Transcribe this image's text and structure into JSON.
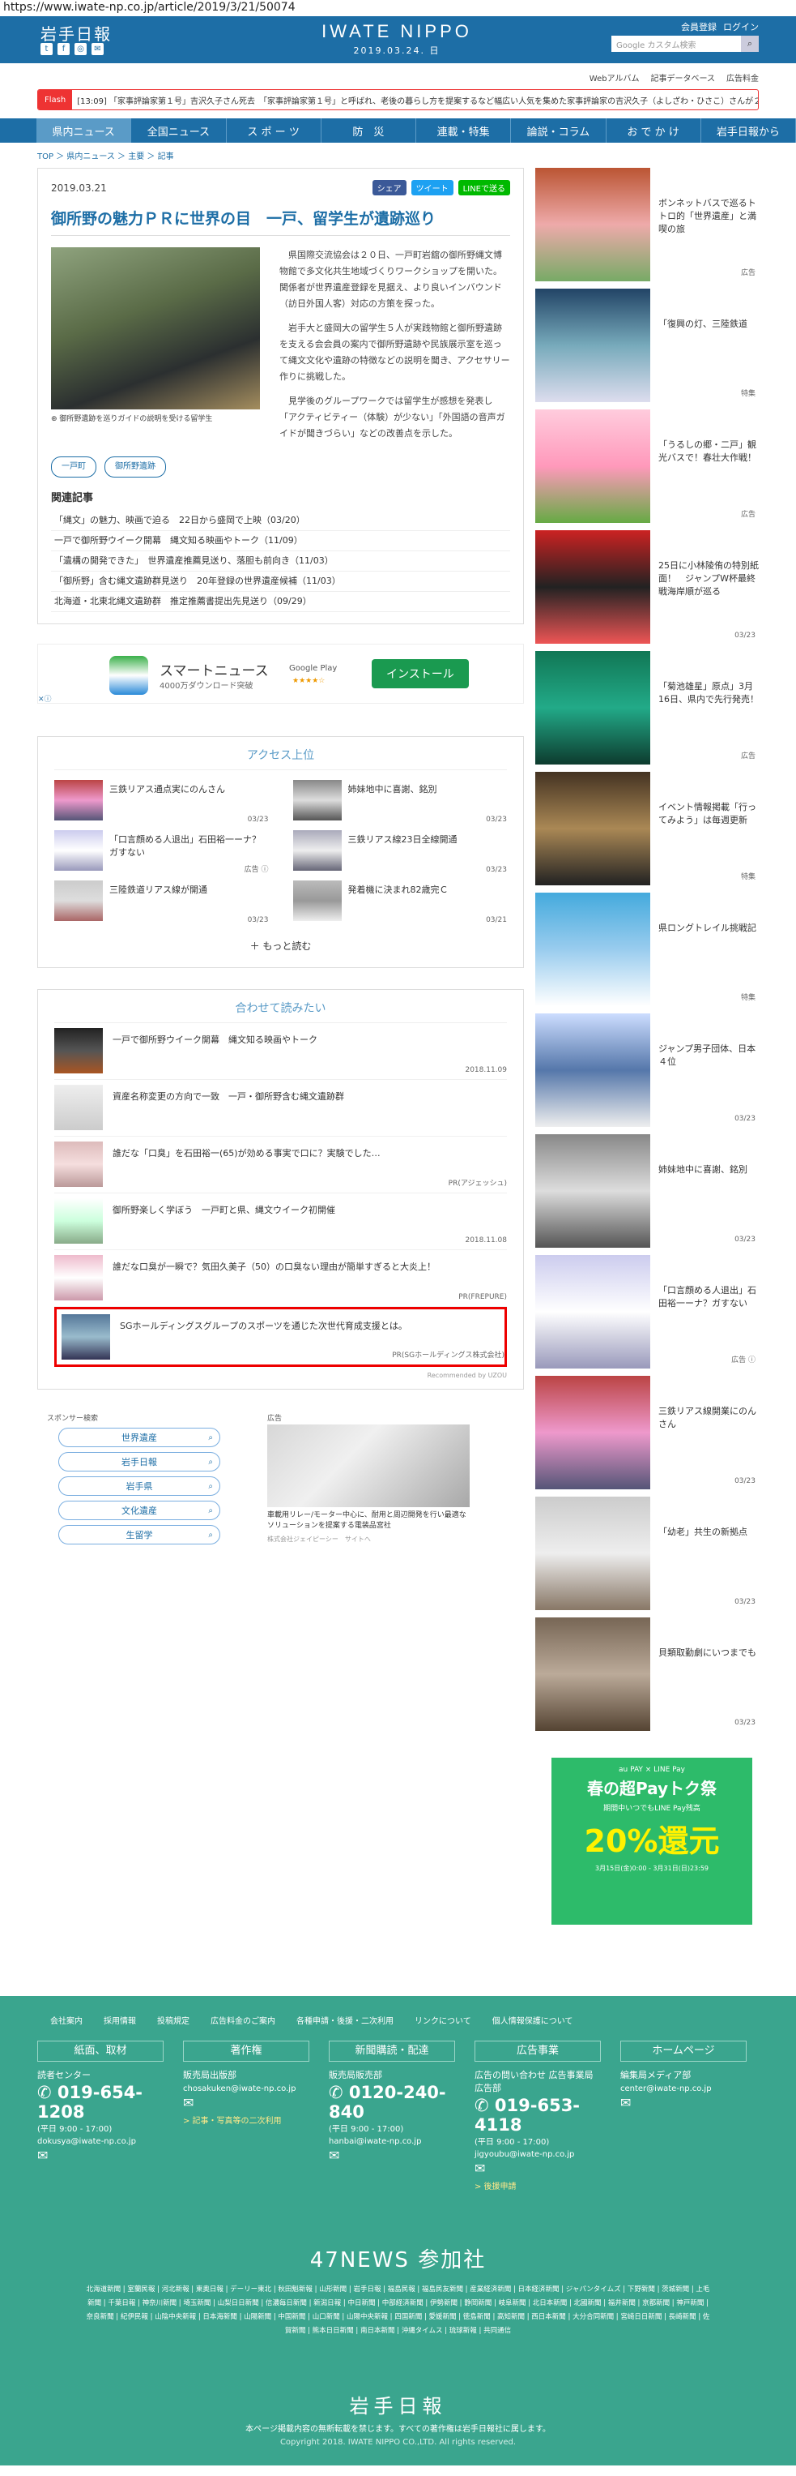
{
  "url": "https://www.iwate-np.co.jp/article/2019/3/21/50074",
  "header": {
    "logo_left": "岩手日報",
    "logo_center": "IWATE NIPPO",
    "date": "2019.03.24. 日",
    "top_links": [
      "会員登録",
      "ログイン"
    ],
    "search_placeholder": "Google カスタム検索",
    "sub_links": [
      "Webアルバム",
      "記事データベース",
      "広告料金"
    ]
  },
  "flash": {
    "tag": "Flash",
    "text": "[13:09] 「家事評論家第１号」吉沢久子さん死去　「家事評論家第１号」と呼ばれ、老後の暮らし方を提案するなど幅広い人気を集めた家事評論家の吉沢久子（よしざわ・ひさこ）さんが２日午…"
  },
  "nav": [
    "県内ニュース",
    "全国ニュース",
    "ス ポ ー ツ",
    "防　災",
    "連載・特集",
    "論説・コラム",
    "お で か け",
    "岩手日報から"
  ],
  "breadcrumb": "TOP ＞ 県内ニュース ＞ 主要 ＞ 記事",
  "article": {
    "date": "2019.03.21",
    "share": [
      "シェア",
      "ツイート",
      "LINEで送る"
    ],
    "title": "御所野の魅力ＰＲに世界の目　一戸、留学生が遺跡巡り",
    "caption": "御所野遺跡を巡りガイドの説明を受ける留学生",
    "paragraphs": [
      "県国際交流協会は２０日、一戸町岩舘の御所野縄文博物館で多文化共生地域づくりワークショップを開いた。関係者が世界遺産登録を見据え、より良いインバウンド（訪日外国人客）対応の方策を探った。",
      "岩手大と盛岡大の留学生５人が実践物館と御所野遺跡を支える会会員の案内で御所野遺跡や民族展示室を巡って縄文文化や遺跡の特徴などの説明を聞き、アクセサリー作りに挑戦した。",
      "見学後のグループワークでは留学生が感想を発表し「アクティビティー（体験）が少ない」「外国語の音声ガイドが聞きづらい」などの改善点を示した。"
    ],
    "tags": [
      "一戸町",
      "御所野遺跡"
    ],
    "related_heading": "関連記事",
    "related": [
      "「縄文」の魅力、映画で迫る　22日から盛岡で上映（03/20）",
      "一戸で御所野ウイーク開幕　縄文知る映画やトーク（11/09）",
      "「遺構の開発できた」　世界遺産推薦見送り、落胆も前向き（11/03）",
      "「御所野」含む縄文遺跡群見送り　20年登録の世界遺産候補（11/03）",
      "北海道・北東北縄文遺跡群　推定推薦書提出先見送り（09/29）"
    ]
  },
  "smartnews_ad": {
    "title": "スマートニュース",
    "sub": "4000万ダウンロード突破",
    "store": "Google Play",
    "stars": "★★★★☆",
    "install": "インストール"
  },
  "ranking": {
    "heading": "アクセス上位",
    "items": [
      {
        "title": "三鉄リアス通点実にのんさん",
        "date": "03/23"
      },
      {
        "title": "姉妹地中に喜謝、銘別",
        "date": "03/23"
      },
      {
        "title": "「口言顔める人退出」石田裕一ーナ？ガすない",
        "date": "広告 ⓘ"
      },
      {
        "title": "三鉄リアス線23日全線開通",
        "date": "03/23"
      },
      {
        "title": "三陸鉄道リアス線が開通",
        "date": "03/23"
      },
      {
        "title": "発着機に決まれ82歳完Ｃ",
        "date": "03/21"
      }
    ],
    "more": "もっと読む"
  },
  "also_read": {
    "heading": "合わせて読みたい",
    "items": [
      {
        "title": "一戸で御所野ウイーク開幕　縄文知る映画やトーク",
        "date": "2018.11.09"
      },
      {
        "title": "資産名称変更の方向で一致　一戸・御所野含む縄文遺跡群",
        "date": ""
      },
      {
        "title": "誰だな「口臭」を石田裕一(65)が効める事実で口に？実験でした…",
        "date": "PR(アジェッシュ)"
      },
      {
        "title": "御所野楽しく学ぼう　一戸町と県、縄文ウイーク初開催",
        "date": "2018.11.08"
      },
      {
        "title": "誰だな口臭が一瞬で？気田久美子（50）の口臭ない理由が簡単すぎると大炎上！",
        "date": "PR(FREPURE)"
      },
      {
        "title": "SGホールディングスグループのスポーツを通じた次世代育成支援とは。",
        "date": "PR(SGホールディングス株式会社)"
      }
    ],
    "recommended": "Recommended by UZOU"
  },
  "sponsor": {
    "heading": "スポンサー検索",
    "items": [
      "世界遺産",
      "岩手日報",
      "岩手県",
      "文化遺産",
      "生留学"
    ]
  },
  "relay_ad": {
    "label": "広告",
    "text": "車載用リレー/モーター中心に、耐用と周辺開発を行い最適なソリューションを提案する電装品宮社",
    "foot": "株式会社ジェイピーシー　サイトへ"
  },
  "sidebar": [
    {
      "title": "ボンネットバスで巡るトトロ的「世界遺産」と満喫の旅",
      "date": "広告"
    },
    {
      "title": "「復興の灯、三陸鉄道",
      "date": "特集"
    },
    {
      "title": "「うるしの郷・二戸」観光バスで！春壮大作戦！",
      "date": "広告"
    },
    {
      "title": "25日に小林陵侑の特別紙面！　ジャンプW杯最終戦海岸順が巡る",
      "date": "03/23"
    },
    {
      "title": "「菊池雄星」原点」3月16日、県内で先行発売！",
      "date": "広告"
    },
    {
      "title": "イベント情報掲載「行ってみよう」は毎週更新",
      "date": "特集"
    },
    {
      "title": "県ロングトレイル挑戦記",
      "date": "特集"
    },
    {
      "title": "ジャンプ男子団体、日本４位",
      "date": "03/23"
    },
    {
      "title": "姉妹地中に喜謝、銘別",
      "date": "03/23"
    },
    {
      "title": "「口言顔める人退出」石田裕一ーナ？ガすない",
      "date": "広告 ⓘ"
    },
    {
      "title": "三鉄リアス線開業にのんさん",
      "date": "03/23"
    },
    {
      "title": "「幼老」共生の新拠点",
      "date": "03/23"
    },
    {
      "title": "貝類取勤劇にいつまでも",
      "date": "03/23"
    }
  ],
  "paypay_ad": {
    "brand": "au PAY × LINE Pay",
    "title": "春の超Payトク祭",
    "sub": "期間中いつでもLINE Pay残高",
    "big": "20%還元",
    "period": "3月15日(金)0:00 - 3月31日(日)23:59"
  },
  "footer": {
    "links": [
      "会社案内",
      "採用情報",
      "投稿規定",
      "広告料金のご案内",
      "各種申請・後援・二次利用",
      "リンクについて",
      "個人情報保護について"
    ],
    "cols": [
      {
        "title": "紙面、取材",
        "label": "読者センター",
        "tel": "019-654-1208",
        "hours": "(平日 9:00 - 17:00)",
        "mail": "dokusya@iwate-np.co.jp",
        "extra": ""
      },
      {
        "title": "著作権",
        "label": "販売局出版部",
        "tel": "",
        "hours": "",
        "mail": "chosakuken@iwate-np.co.jp",
        "extra": "> 記事・写真等の二次利用"
      },
      {
        "title": "新聞購読・配達",
        "label": "販売局販売部",
        "tel": "0120-240-840",
        "hours": "(平日 9:00 - 17:00)",
        "mail": "hanbai@iwate-np.co.jp",
        "extra": ""
      },
      {
        "title": "広告事業",
        "label": "広告の問い合わせ 広告事業局広告部",
        "tel": "019-653-4118",
        "hours": "(平日 9:00 - 17:00)",
        "mail": "jigyoubu@iwate-np.co.jp",
        "extra": "> 後援申請"
      },
      {
        "title": "ホームページ",
        "label": "編集局メディア部",
        "tel": "",
        "hours": "",
        "mail": "center@iwate-np.co.jp",
        "extra": ""
      }
    ],
    "news47": "47NEWS 参加社",
    "papers": "北海道新聞 | 室蘭民報 | 河北新報 | 東奥日報 | デーリー東北 | 秋田魁新報 | 山形新聞 | 岩手日報 | 福島民報 | 福島民友新聞 | 産業経済新聞 | 日本経済新聞 | ジャパンタイムズ | 下野新聞 | 茨城新聞 | 上毛新聞 | 千葉日報 | 神奈川新聞 | 埼玉新聞 | 山梨日日新聞 | 信濃毎日新聞 | 新潟日報 | 中日新聞 | 中部経済新聞 | 伊勢新聞 | 静岡新聞 | 岐阜新聞 | 北日本新聞 | 北國新聞 | 福井新聞 | 京都新聞 | 神戸新聞 | 奈良新聞 | 紀伊民報 | 山陰中央新報 | 日本海新聞 | 山陽新聞 | 中国新聞 | 山口新聞 | 山陽中央新報 | 四国新聞 | 愛媛新聞 | 徳島新聞 | 高知新聞 | 西日本新聞 | 大分合同新聞 | 宮崎日日新聞 | 長崎新聞 | 佐賀新聞 | 熊本日日新聞 | 南日本新聞 | 沖縄タイムス | 琉球新報 | 共同通信",
    "logo": "岩手日報",
    "copy1": "本ページ掲載内容の無断転載を禁じます。すべての著作権は岩手日報社に属します。",
    "copy2": "Copyright 2018. IWATE NIPPO CO.,LTD. All rights reserved."
  }
}
